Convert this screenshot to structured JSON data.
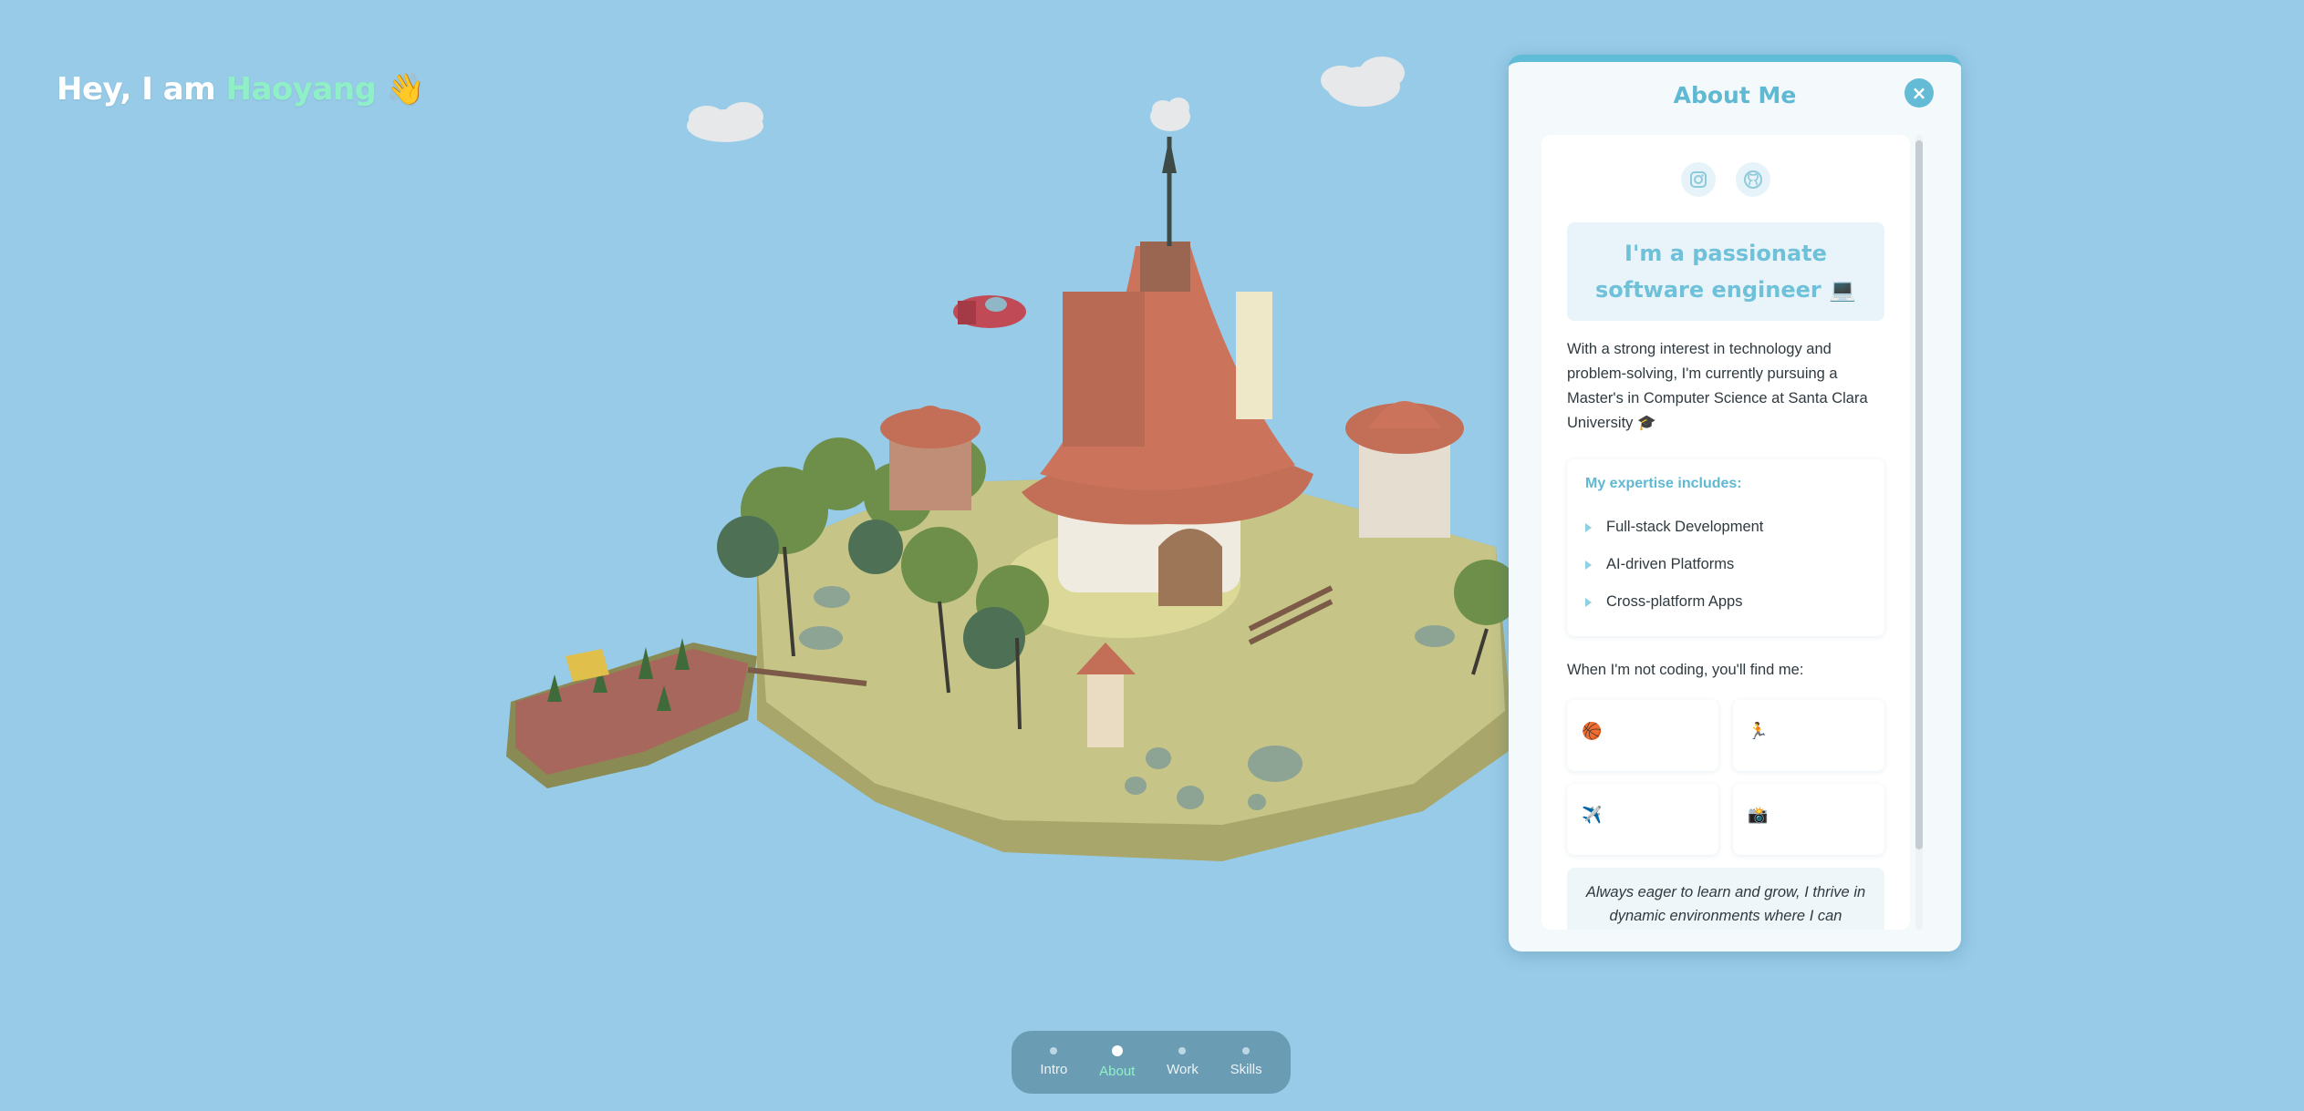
{
  "greeting": {
    "prefix": "Hey, I am",
    "name": "Haoyang",
    "emoji": "👋"
  },
  "panel": {
    "title": "About Me",
    "close_label": "×",
    "social": [
      {
        "icon": "instagram-icon"
      },
      {
        "icon": "github-icon"
      }
    ],
    "headline": "I'm a passionate software engineer 💻",
    "intro": "With a strong interest in technology and problem-solving, I'm currently pursuing a Master's in Computer Science at Santa Clara University 🎓",
    "expertise": {
      "title": "My expertise includes:",
      "items": [
        "Full-stack Development",
        "AI-driven Platforms",
        "Cross-platform Apps"
      ]
    },
    "hobbies": {
      "label": "When I'm not coding, you'll find me:",
      "items": [
        "🏀",
        "🏃",
        "✈️",
        "📸"
      ]
    },
    "quote": "Always eager to learn and grow, I thrive in dynamic environments where I can"
  },
  "nav": {
    "items": [
      {
        "label": "Intro",
        "active": false
      },
      {
        "label": "About",
        "active": true
      },
      {
        "label": "Work",
        "active": false
      },
      {
        "label": "Skills",
        "active": false
      }
    ]
  },
  "colors": {
    "sky": "#97cbe7",
    "accent": "#5fb9d3",
    "name_highlight": "#8ff0c8"
  }
}
